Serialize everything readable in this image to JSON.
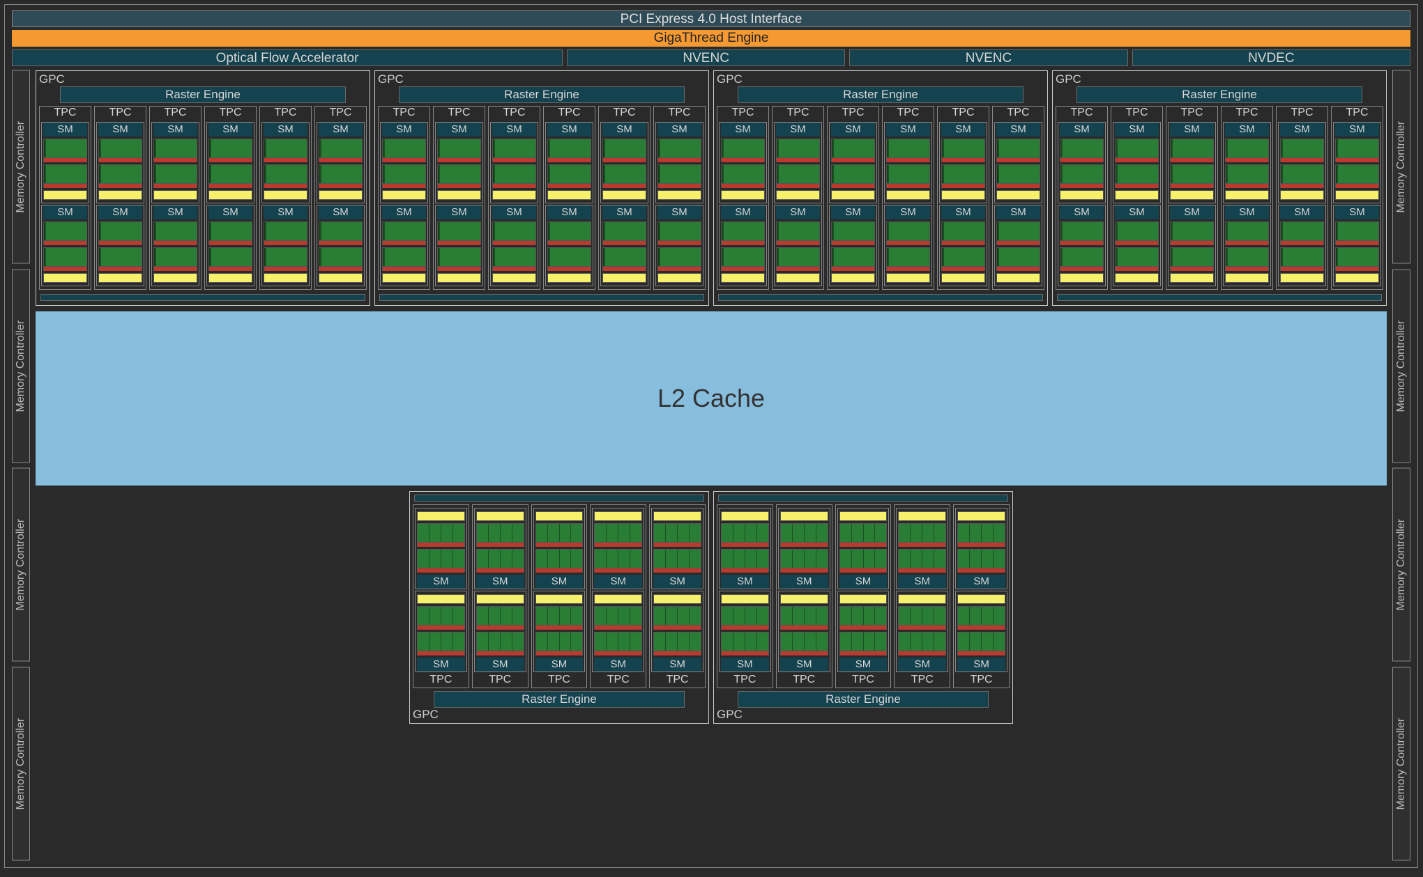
{
  "top": {
    "pcie": "PCI Express 4.0 Host Interface",
    "gte": "GigaThread Engine",
    "ofa": "Optical Flow Accelerator",
    "enc1": "NVENC",
    "enc2": "NVENC",
    "dec": "NVDEC"
  },
  "mem": {
    "label": "Memory Controller",
    "count_each_side": 4
  },
  "l2": "L2 Cache",
  "labels": {
    "gpc": "GPC",
    "raster": "Raster Engine",
    "tpc": "TPC",
    "sm": "SM"
  },
  "layout": {
    "top_gpc_count": 4,
    "top_tpc_per_gpc": 6,
    "top_sm_per_tpc": 2,
    "bottom_gpc_count": 2,
    "bottom_tpc_per_gpc": 5,
    "bottom_sm_per_tpc": 2,
    "core_columns": 4
  }
}
